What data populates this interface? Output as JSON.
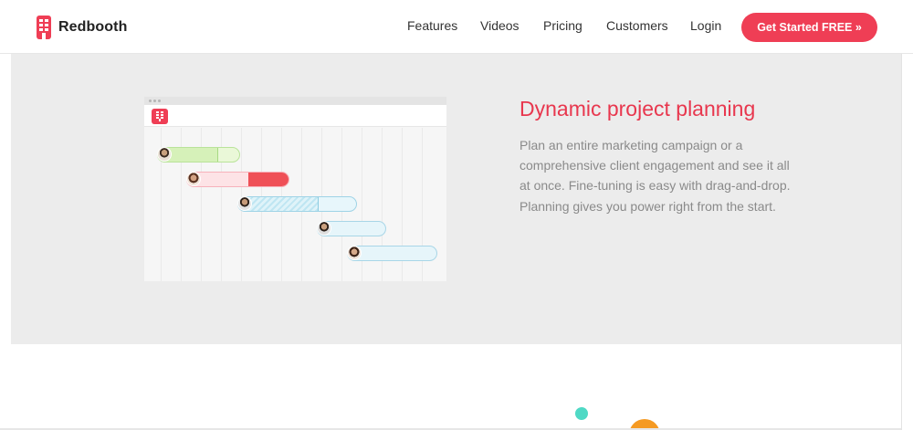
{
  "brand": {
    "name": "Redbooth",
    "logo_icon": "building-icon",
    "accent": "#ef3e55"
  },
  "nav": {
    "links": [
      {
        "label": "Features"
      },
      {
        "label": "Videos"
      },
      {
        "label": "Pricing"
      },
      {
        "label": "Customers"
      },
      {
        "label": "Login"
      }
    ],
    "cta_label": "Get Started FREE »"
  },
  "feature": {
    "heading": "Dynamic project planning",
    "body": "Plan an entire marketing campaign or a comprehensive client engagement and see it all at once. Fine-tuning is easy with drag-and-drop. Planning gives you power right from the start.",
    "heading_color": "#e8374e",
    "mockup": {
      "tasks": [
        {
          "avatar": "avatar-male-1",
          "color": "green",
          "progress": 0.7
        },
        {
          "avatar": "avatar-female-1",
          "color": "red",
          "progress": 0.5
        },
        {
          "avatar": "avatar-male-2",
          "color": "blue-striped",
          "progress": 0.7
        },
        {
          "avatar": "avatar-male-3",
          "color": "light-blue",
          "progress": 0
        },
        {
          "avatar": "avatar-female-2",
          "color": "light-blue",
          "progress": 0
        }
      ]
    }
  }
}
